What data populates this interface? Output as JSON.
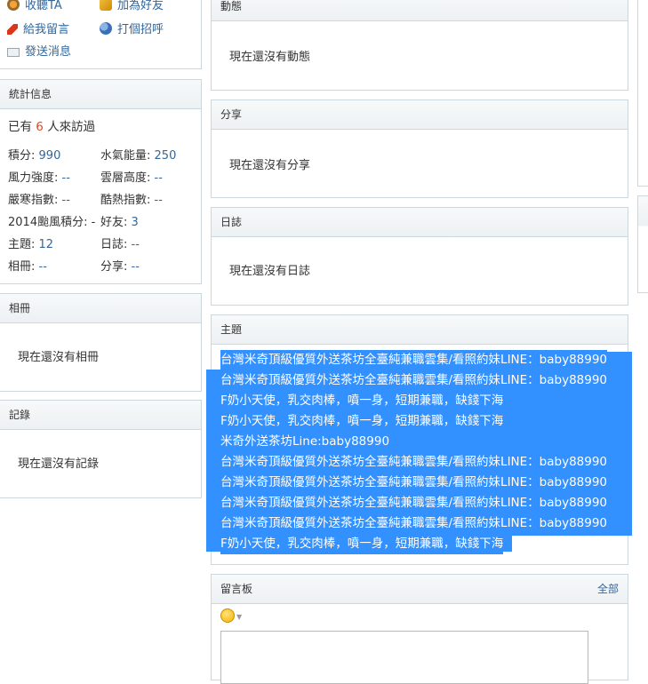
{
  "profile_links": {
    "collect": "收聽TA",
    "add_friend": "加為好友",
    "leave_message": "給我留言",
    "greet": "打個招呼",
    "send_message": "發送消息"
  },
  "stats": {
    "header": "統計信息",
    "visitors_prefix": "已有",
    "visitors_count": "6",
    "visitors_suffix": "人來訪過",
    "points_label": "積分:",
    "points_value": "990",
    "water_label": "水氣能量:",
    "water_value": "250",
    "wind_label": "風力強度:",
    "wind_value": "--",
    "cloud_label": "雲層高度:",
    "cloud_value": "--",
    "cold_label": "嚴寒指數:",
    "cold_value": "--",
    "heat_label": "酷熱指數:",
    "heat_value": "--",
    "typhoon_label": "2014颱風積分:",
    "typhoon_value": "-",
    "friends_label": "好友:",
    "friends_value": "3",
    "threads_label": "主題:",
    "threads_value": "12",
    "blogs_label": "日誌:",
    "blogs_value": "--",
    "albums_label": "相冊:",
    "albums_value": "--",
    "shares_label": "分享:",
    "shares_value": "--"
  },
  "album": {
    "header": "相冊",
    "empty": "現在還沒有相冊"
  },
  "record": {
    "header": "記錄",
    "empty": "現在還沒有記錄"
  },
  "feed": {
    "header": "動態",
    "empty": "現在還沒有動態"
  },
  "share": {
    "header": "分享",
    "empty": "現在還沒有分享"
  },
  "blog": {
    "header": "日誌",
    "empty": "現在還沒有日誌"
  },
  "threads": {
    "header": "主題",
    "items": [
      "台灣米奇頂級優質外送茶坊全臺純兼職雲集/看照約妹LINE：baby88990",
      "台灣米奇頂級優質外送茶坊全臺純兼職雲集/看照約妹LINE：baby88990",
      "F奶小天使，乳交肉棒，噴一身，短期兼職，缺錢下海",
      "F奶小天使，乳交肉棒，噴一身，短期兼職，缺錢下海",
      "米奇外送茶坊Line:baby88990",
      "台灣米奇頂級優質外送茶坊全臺純兼職雲集/看照約妹LINE：baby88990",
      "台灣米奇頂級優質外送茶坊全臺純兼職雲集/看照約妹LINE：baby88990",
      "台灣米奇頂級優質外送茶坊全臺純兼職雲集/看照約妹LINE：baby88990",
      "台灣米奇頂級優質外送茶坊全臺純兼職雲集/看照約妹LINE：baby88990",
      "F奶小天使，乳交肉棒，噴一身，短期兼職，缺錢下海"
    ]
  },
  "guestbook": {
    "header": "留言板",
    "all_link": "全部"
  },
  "colors": {
    "selection": "#3390ff",
    "link": "#336699",
    "accent_red": "#e0472a"
  }
}
